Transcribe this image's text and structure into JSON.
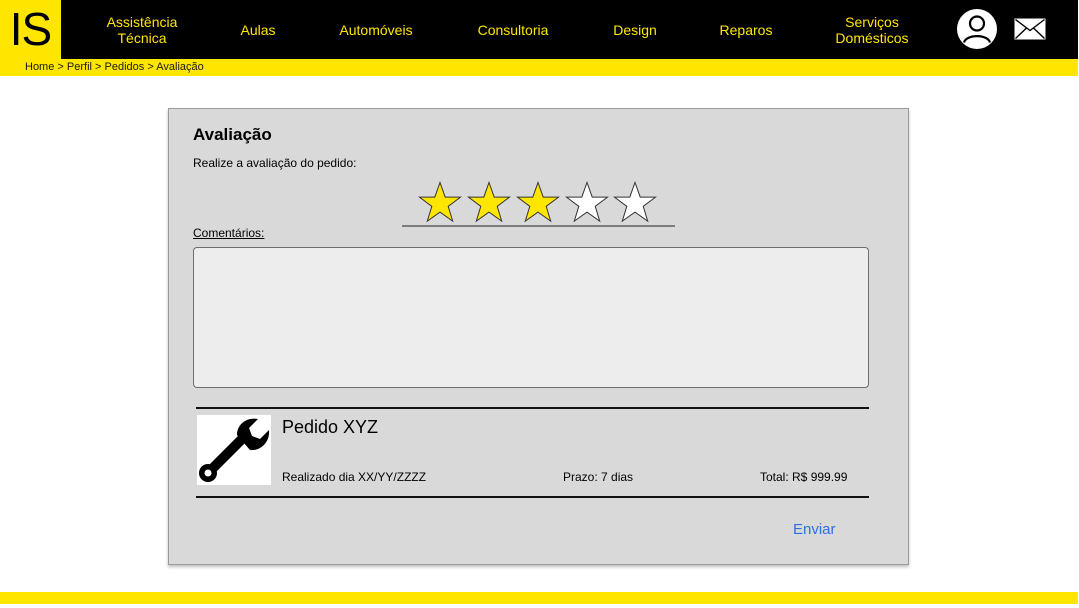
{
  "logo": {
    "text": "IS"
  },
  "nav": {
    "items": [
      {
        "label": "Assistência Técnica"
      },
      {
        "label": "Aulas"
      },
      {
        "label": "Automóveis"
      },
      {
        "label": "Consultoria"
      },
      {
        "label": "Design"
      },
      {
        "label": "Reparos"
      },
      {
        "label": "Serviços Domésticos"
      }
    ],
    "icons": [
      "user-icon",
      "mail-icon"
    ]
  },
  "breadcrumb": {
    "items": [
      "Home",
      "Perfil",
      "Pedidos",
      "Avaliação"
    ],
    "separator": ">"
  },
  "review": {
    "title": "Avaliação",
    "subtitle": "Realize a avaliação do pedido:",
    "rating": 3,
    "rating_max": 5,
    "comments_label": "Comentários:",
    "comments_value": ""
  },
  "order": {
    "name": "Pedido XYZ",
    "date": "Realizado dia XX/YY/ZZZZ",
    "deadline": "Prazo: 7 dias",
    "total": "Total: R$ 999.99",
    "icon": "wrench-icon"
  },
  "actions": {
    "send_label": "Enviar"
  },
  "colors": {
    "brand_yellow": "#FFE600",
    "header_black": "#000000",
    "card_bg": "#D9D9D9",
    "link_blue": "#2F6FE0"
  }
}
